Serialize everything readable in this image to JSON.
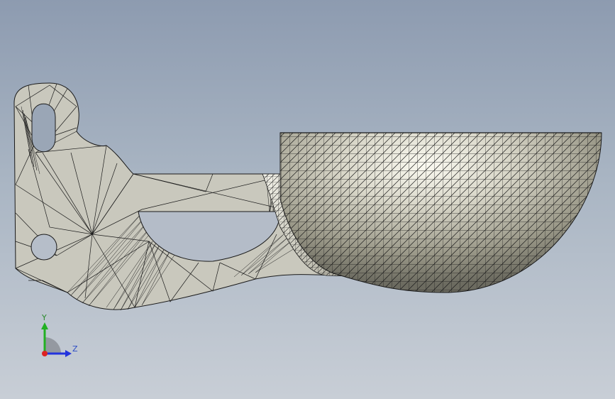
{
  "viewport": {
    "background_top": "#8d9bb0",
    "background_bottom": "#c8ced6"
  },
  "model": {
    "name": "bracket-with-hemispherical-bowl",
    "render_mode": "shaded-with-mesh-edges",
    "face_color": "#c9c8bd",
    "edge_color": "#1a1a1a"
  },
  "triad": {
    "y_label": "Y",
    "z_label": "Z",
    "y_color": "#22b022",
    "z_color": "#2233dd",
    "x_color": "#dd2222"
  }
}
